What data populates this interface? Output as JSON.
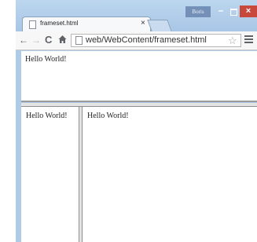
{
  "caption_fragment": "",
  "browser": {
    "tab": {
      "title": "frameset.html",
      "close": "×"
    },
    "user_badge": "Boris",
    "window_controls": {
      "minimize": "–",
      "close": "×"
    },
    "toolbar": {
      "back": "←",
      "forward": "→",
      "reload": "C",
      "url": "web/WebContent/frameset.html",
      "star": "☆"
    }
  },
  "frames": {
    "top": {
      "text": "Hello World!"
    },
    "left": {
      "text": "Hello World!"
    },
    "right": {
      "text": "Hello World!"
    }
  },
  "colors": {
    "chrome_frame": "#aecbe8",
    "close_button": "#c9483c",
    "user_badge": "#7590b8"
  },
  "icons": [
    "page-icon",
    "back-arrow-icon",
    "forward-arrow-icon",
    "reload-icon",
    "home-icon",
    "star-icon",
    "menu-icon",
    "minimize-icon",
    "maximize-icon",
    "close-icon"
  ]
}
